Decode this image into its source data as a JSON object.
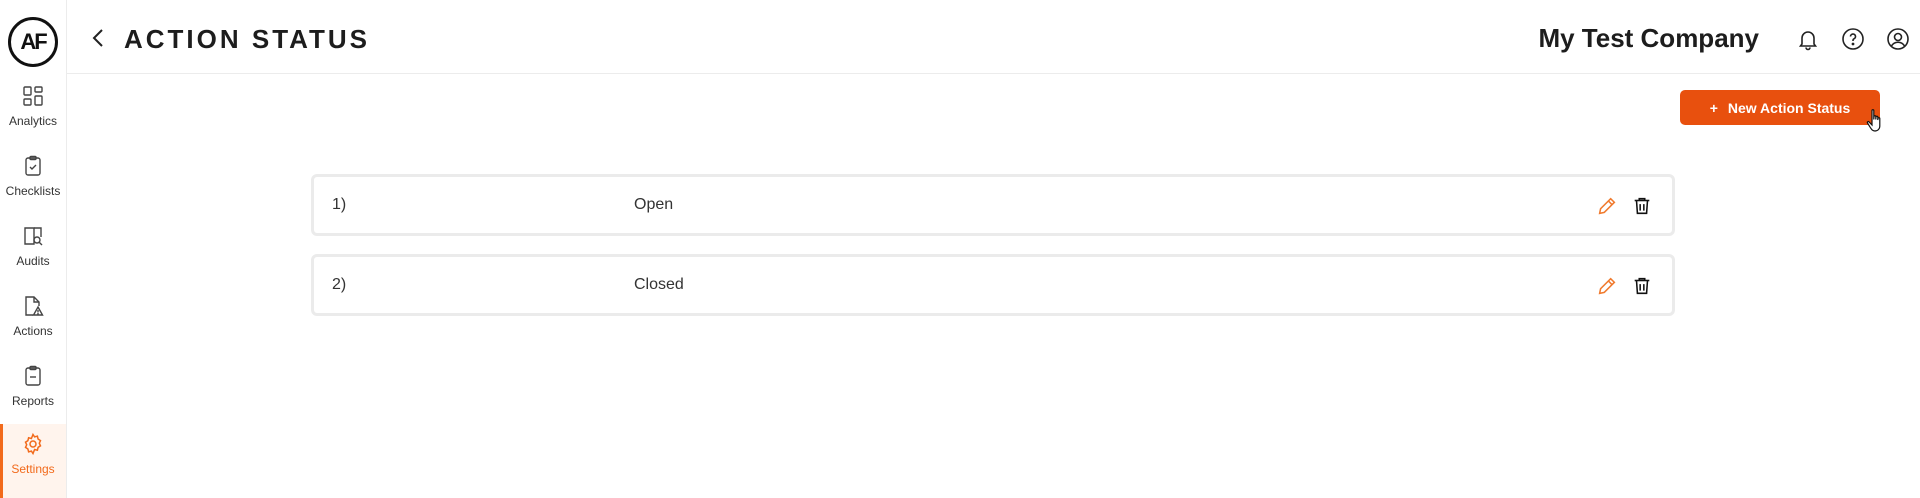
{
  "brand": {
    "logo_text": "AF",
    "accent": "#e8500e"
  },
  "sidebar": {
    "items": [
      {
        "label": "Analytics",
        "icon": "dashboard-grid-icon",
        "active": false
      },
      {
        "label": "Checklists",
        "icon": "clipboard-check-icon",
        "active": false
      },
      {
        "label": "Audits",
        "icon": "document-search-icon",
        "active": false
      },
      {
        "label": "Actions",
        "icon": "document-warning-icon",
        "active": false
      },
      {
        "label": "Reports",
        "icon": "clipboard-icon",
        "active": false
      },
      {
        "label": "Settings",
        "icon": "gear-icon",
        "active": true
      }
    ]
  },
  "header": {
    "title": "ACTION STATUS",
    "company": "My Test Company",
    "icons": [
      "bell-icon",
      "help-icon",
      "user-icon"
    ]
  },
  "toolbar": {
    "new_button_label": "New Action Status",
    "new_button_icon": "+"
  },
  "statuses": [
    {
      "number": "1)",
      "name": "Open"
    },
    {
      "number": "2)",
      "name": "Closed"
    }
  ]
}
